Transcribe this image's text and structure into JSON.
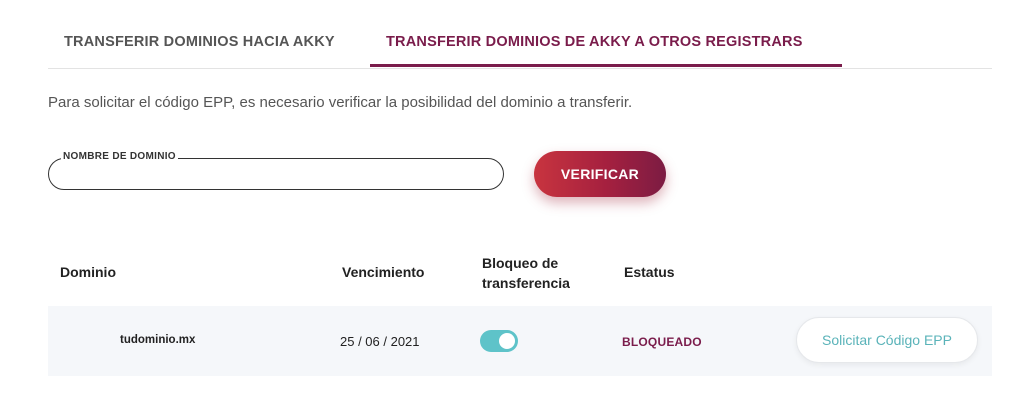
{
  "tabs": [
    {
      "label": "TRANSFERIR DOMINIOS HACIA AKKY",
      "active": false
    },
    {
      "label": "TRANSFERIR DOMINIOS DE AKKY A OTROS REGISTRARS",
      "active": true
    }
  ],
  "intro_text": "Para solicitar el código EPP, es necesario verificar la posibilidad del dominio a transferir.",
  "domain_field": {
    "label": "NOMBRE DE DOMINIO",
    "value": ""
  },
  "verify_button": "VERIFICAR",
  "table": {
    "headers": [
      "Dominio",
      "Vencimiento",
      "Bloqueo de transferencia",
      "Estatus"
    ],
    "header_block_line1": "Bloqueo de",
    "header_block_line2": "transferencia",
    "rows": [
      {
        "domain": "tudominio.mx",
        "expiry": "25 / 06 / 2021",
        "transfer_lock": true,
        "status": "BLOQUEADO",
        "action": "Solicitar Código EPP"
      }
    ]
  },
  "colors": {
    "accent": "#7a1c4b",
    "button_gradient_start": "#c8343f",
    "toggle_on": "#5ec3c9",
    "epp_text": "#5ab3b9"
  }
}
